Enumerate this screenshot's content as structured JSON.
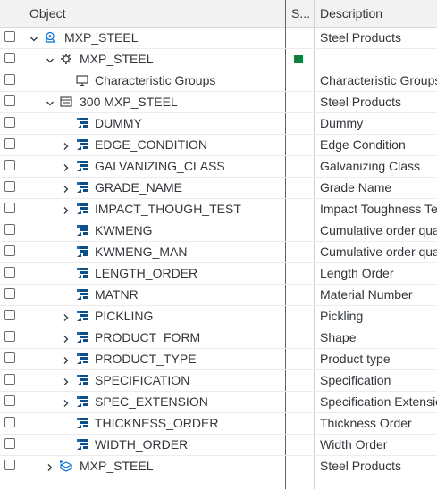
{
  "header": {
    "object": "Object",
    "status": "S...",
    "description": "Description"
  },
  "rows": [
    {
      "level": 0,
      "expander": "down",
      "icon": "class-icon",
      "name": "MXP_STEEL",
      "status": "",
      "description": "Steel Products"
    },
    {
      "level": 1,
      "expander": "down",
      "icon": "characteristic-gear-icon",
      "name": "MXP_STEEL",
      "status": "green",
      "description": ""
    },
    {
      "level": 2,
      "expander": "none",
      "icon": "monitor-icon",
      "name": "Characteristic Groups",
      "status": "",
      "description": "Characteristic Groups"
    },
    {
      "level": 1,
      "expander": "down",
      "icon": "folder-list-icon",
      "name": "300 MXP_STEEL",
      "status": "",
      "description": "Steel Products"
    },
    {
      "level": 2,
      "expander": "none",
      "icon": "characteristic-icon",
      "name": "DUMMY",
      "status": "",
      "description": "Dummy"
    },
    {
      "level": 2,
      "expander": "right",
      "icon": "characteristic-icon",
      "name": "EDGE_CONDITION",
      "status": "",
      "description": "Edge Condition"
    },
    {
      "level": 2,
      "expander": "right",
      "icon": "characteristic-icon",
      "name": "GALVANIZING_CLASS",
      "status": "",
      "description": "Galvanizing Class"
    },
    {
      "level": 2,
      "expander": "right",
      "icon": "characteristic-icon",
      "name": "GRADE_NAME",
      "status": "",
      "description": "Grade Name"
    },
    {
      "level": 2,
      "expander": "right",
      "icon": "characteristic-icon",
      "name": "IMPACT_THOUGH_TEST",
      "status": "",
      "description": "Impact Toughness Test"
    },
    {
      "level": 2,
      "expander": "none",
      "icon": "characteristic-icon",
      "name": "KWMENG",
      "status": "",
      "description": "Cumulative order quantity"
    },
    {
      "level": 2,
      "expander": "none",
      "icon": "characteristic-icon",
      "name": "KWMENG_MAN",
      "status": "",
      "description": "Cumulative order quantity"
    },
    {
      "level": 2,
      "expander": "none",
      "icon": "characteristic-icon",
      "name": "LENGTH_ORDER",
      "status": "",
      "description": "Length Order"
    },
    {
      "level": 2,
      "expander": "none",
      "icon": "characteristic-icon",
      "name": "MATNR",
      "status": "",
      "description": "Material Number"
    },
    {
      "level": 2,
      "expander": "right",
      "icon": "characteristic-icon",
      "name": "PICKLING",
      "status": "",
      "description": "Pickling"
    },
    {
      "level": 2,
      "expander": "right",
      "icon": "characteristic-icon",
      "name": "PRODUCT_FORM",
      "status": "",
      "description": "Shape"
    },
    {
      "level": 2,
      "expander": "right",
      "icon": "characteristic-icon",
      "name": "PRODUCT_TYPE",
      "status": "",
      "description": "Product type"
    },
    {
      "level": 2,
      "expander": "right",
      "icon": "characteristic-icon",
      "name": "SPECIFICATION",
      "status": "",
      "description": "Specification"
    },
    {
      "level": 2,
      "expander": "right",
      "icon": "characteristic-icon",
      "name": "SPEC_EXTENSION",
      "status": "",
      "description": "Specification Extension"
    },
    {
      "level": 2,
      "expander": "none",
      "icon": "characteristic-icon",
      "name": "THICKNESS_ORDER",
      "status": "",
      "description": "Thickness Order"
    },
    {
      "level": 2,
      "expander": "none",
      "icon": "characteristic-icon",
      "name": "WIDTH_ORDER",
      "status": "",
      "description": "Width Order"
    },
    {
      "level": 1,
      "expander": "right",
      "icon": "class-add-icon",
      "name": "MXP_STEEL",
      "status": "",
      "description": "Steel Products"
    }
  ],
  "colors": {
    "status_green": "#107e3e",
    "icon_blue": "#0a6ed1",
    "header_bg": "#f2f2f2"
  }
}
